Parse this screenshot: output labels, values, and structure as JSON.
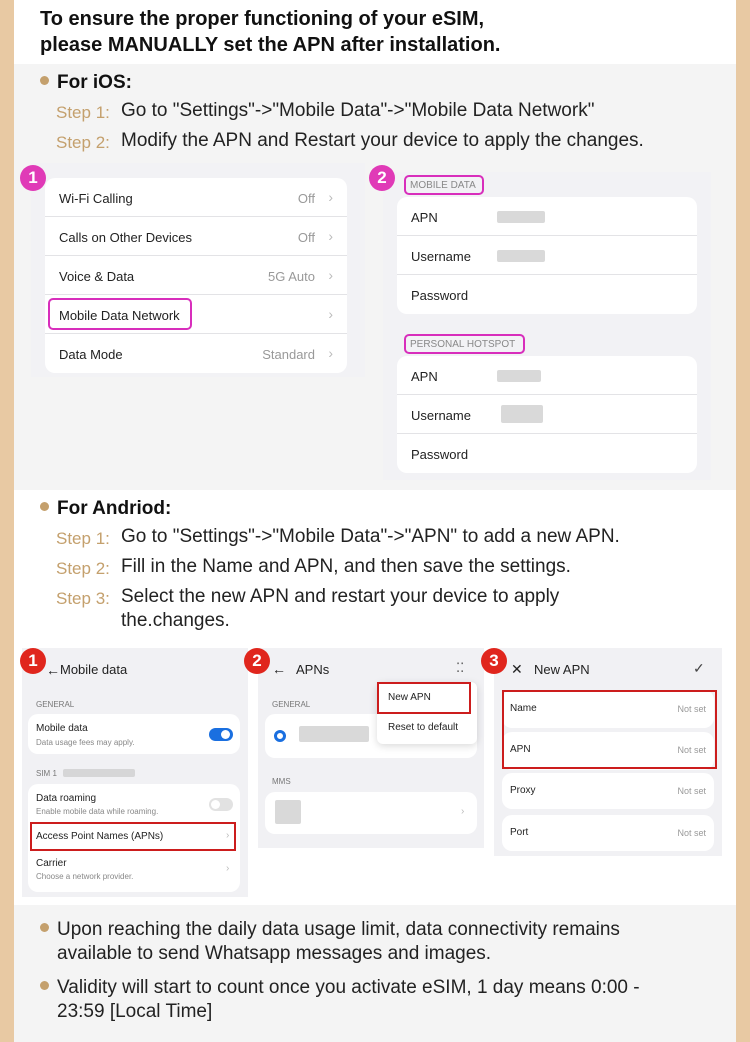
{
  "title": {
    "line1": "To ensure the proper functioning of your eSIM,",
    "line2": "please MANUALLY set the APN after installation."
  },
  "ios": {
    "heading": "For iOS:",
    "step1_label": "Step 1:",
    "step1_text": "Go to  \"Settings\"->\"Mobile Data\"->\"Mobile Data Network\"",
    "step2_label": "Step 2:",
    "step2_text": "Modify the APN and Restart your device to apply the changes.",
    "shot1": {
      "number": "1",
      "rows": [
        {
          "label": "Wi-Fi Calling",
          "value": "Off"
        },
        {
          "label": "Calls on Other Devices",
          "value": "Off"
        },
        {
          "label": "Voice & Data",
          "value": "5G Auto"
        },
        {
          "label": "Mobile Data Network",
          "value": ""
        },
        {
          "label": "Data Mode",
          "value": "Standard"
        }
      ]
    },
    "shot2": {
      "number": "2",
      "mobile_data_header": "MOBILE DATA",
      "hotspot_header": "PERSONAL HOTSPOT",
      "apn": "APN",
      "username": "Username",
      "password": "Password"
    }
  },
  "android": {
    "heading": "For Andriod:",
    "step1_label": "Step 1:",
    "step1_text": "Go to \"Settings\"->\"Mobile Data\"->\"APN\" to add a new APN.",
    "step2_label": "Step 2:",
    "step2_text": "Fill in the Name and APN, and then save the settings.",
    "step3_label": "Step 3:",
    "step3_line1": "Select the new APN and restart your device to apply",
    "step3_line2": "the.changes.",
    "shot1": {
      "number": "1",
      "title": "Mobile data",
      "general": "GENERAL",
      "mobile_data": "Mobile data",
      "mobile_data_sub": "Data usage fees may apply.",
      "sim": "SIM 1",
      "roaming": "Data roaming",
      "roaming_sub": "Enable mobile data while roaming.",
      "apns": "Access Point Names (APNs)",
      "carrier": "Carrier",
      "carrier_sub": "Choose a network provider."
    },
    "shot2": {
      "number": "2",
      "title": "APNs",
      "general": "GENERAL",
      "mms": "MMS",
      "new_apn": "New APN",
      "reset": "Reset to default"
    },
    "shot3": {
      "number": "3",
      "title": "New APN",
      "name": "Name",
      "apn": "APN",
      "proxy": "Proxy",
      "port": "Port",
      "not_set": "Not set"
    }
  },
  "notes": {
    "note1_line1": "Upon reaching the daily data usage limit, data connectivity remains",
    "note1_line2": "available to send Whatsapp messages and images.",
    "note2_line1": "Validity will start to count once you activate eSIM, 1 day means 0:00 -",
    "note2_line2": "23:59 [Local Time]"
  },
  "colors": {
    "accent": "#c4a06d",
    "frame": "#e8c9a3",
    "pink": "#e03ab7",
    "red": "#e0261d",
    "toggle": "#1a6fe0"
  }
}
